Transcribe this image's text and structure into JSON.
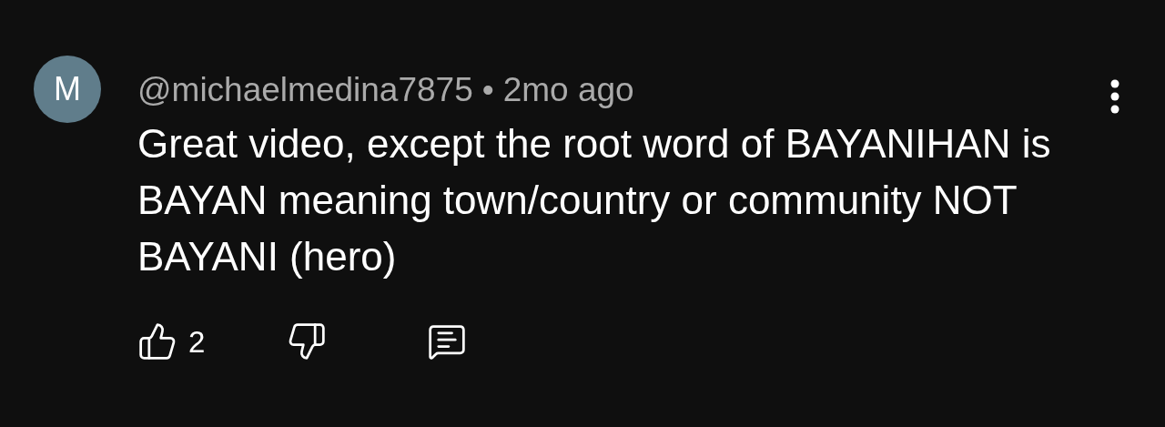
{
  "comment": {
    "avatar_letter": "M",
    "author": "@michaelmedina7875",
    "separator": "•",
    "time": "2mo ago",
    "text": "Great video, except the root word of BAYANIHAN is BAYAN meaning town/country or community NOT BAYANI (hero)",
    "like_count": "2"
  }
}
